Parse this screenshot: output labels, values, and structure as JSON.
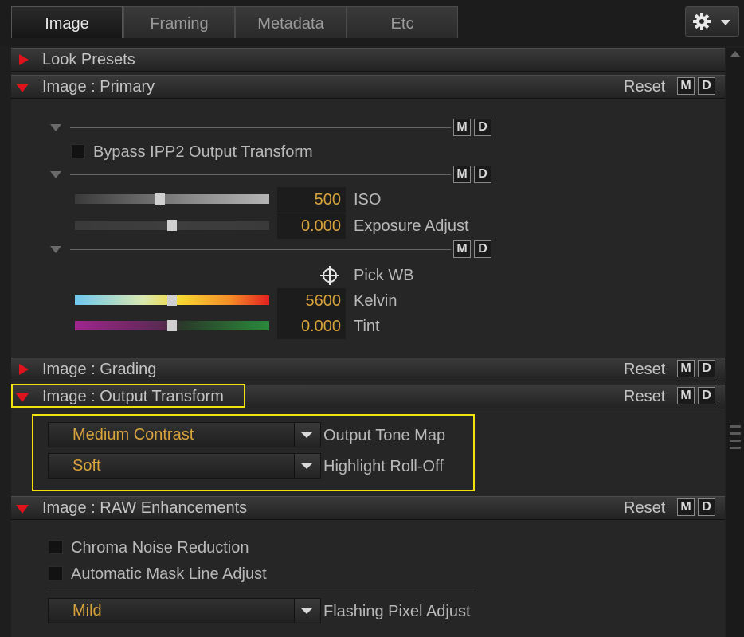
{
  "tabs": [
    "Image",
    "Framing",
    "Metadata",
    "Etc"
  ],
  "md": {
    "m": "M",
    "d": "D"
  },
  "reset_label": "Reset",
  "sections": {
    "look_presets": "Look Presets",
    "primary": "Image : Primary",
    "grading": "Image : Grading",
    "output_transform": "Image : Output Transform",
    "raw_enhancements": "Image : RAW Enhancements"
  },
  "primary": {
    "bypass_label": "Bypass IPP2 Output Transform",
    "iso": {
      "value": "500",
      "label": "ISO",
      "slider": 0.44
    },
    "exposure": {
      "value": "0.000",
      "label": "Exposure Adjust",
      "slider": 0.5
    },
    "pick_wb": "Pick WB",
    "kelvin": {
      "value": "5600",
      "label": "Kelvin",
      "slider": 0.5
    },
    "tint": {
      "value": "0.000",
      "label": "Tint",
      "slider": 0.5
    }
  },
  "output_transform": {
    "tone_map": {
      "value": "Medium Contrast",
      "label": "Output Tone Map"
    },
    "highlight": {
      "value": "Soft",
      "label": "Highlight Roll-Off"
    }
  },
  "raw_enhancements": {
    "chroma_label": "Chroma Noise Reduction",
    "mask_label": "Automatic Mask Line Adjust",
    "flashing": {
      "value": "Mild",
      "label": "Flashing Pixel Adjust"
    }
  },
  "colors": {
    "accent_red": "#e0121b",
    "value_orange": "#d8a23c",
    "highlight_yellow": "#f2e20c"
  }
}
